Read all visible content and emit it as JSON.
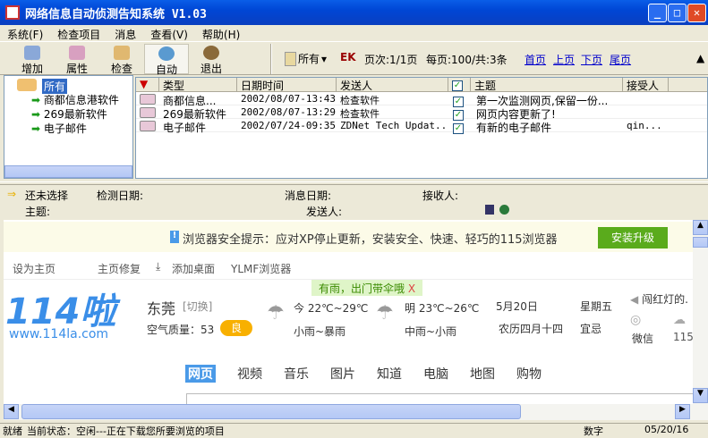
{
  "window": {
    "title": "网络信息自动侦测告知系统 V1.03"
  },
  "menu": [
    "系统(F)",
    "检查项目",
    "消息",
    "查看(V)",
    "帮助(H)"
  ],
  "toolbar": {
    "buttons": [
      "增加",
      "属性",
      "检查",
      "自动",
      "退出"
    ],
    "filter": "所有",
    "page_info": "页次:1/1页",
    "per_page": "每页:100/共:3条",
    "nav": [
      "首页",
      "上页",
      "下页",
      "尾页"
    ]
  },
  "tree": {
    "root": "所有",
    "items": [
      "商都信息港软件",
      "269最新软件",
      "电子邮件"
    ]
  },
  "list": {
    "columns": [
      "类型",
      "日期时间",
      "发送人",
      "主题",
      "接受人"
    ],
    "rows": [
      {
        "type": "商都信息...",
        "date": "2002/08/07-13:43",
        "sender": "检查软件",
        "subject": "第一次监测网页,保留一份...",
        "receiver": ""
      },
      {
        "type": "269最新软件",
        "date": "2002/08/07-13:29",
        "sender": "检查软件",
        "subject": "网页内容更新了!",
        "receiver": ""
      },
      {
        "type": "电子邮件",
        "date": "2002/07/24-09:35",
        "sender": "ZDNet Tech Updat...",
        "subject": "有新的电子邮件",
        "receiver": "qin..."
      }
    ]
  },
  "info": {
    "state": "还未选择",
    "check_date": "检测日期:",
    "msg_date": "消息日期:",
    "receiver": "接收人:",
    "subject": "主题:",
    "sender": "发送人:"
  },
  "browser": {
    "banner": "浏览器安全提示：应对XP停止更新，安装安全、快速、轻巧的115浏览器",
    "install": "安装升级",
    "links": [
      "设为主页",
      "主页修复",
      "添加桌面",
      "YLMF浏览器"
    ],
    "logo": "114啦",
    "logo_url": "www.114la.com",
    "tip": "有雨，出门带伞哦",
    "tip_close": "X",
    "city": "东莞",
    "switch": "[切换]",
    "air_label": "空气质量：53",
    "air_level": "良",
    "today": "今 22℃~29℃",
    "today_desc": "小雨~暴雨",
    "tomorrow": "明 23℃~26℃",
    "tomorrow_desc": "中雨~小雨",
    "date": "5月20日",
    "lunar": "农历四月十四",
    "weekday": "星期五",
    "yiji": "宜忌",
    "news": "闯红灯的.",
    "wechat": "微信",
    "s115": "115",
    "tabs": [
      "网页",
      "视频",
      "音乐",
      "图片",
      "知道",
      "电脑",
      "地图",
      "购物"
    ]
  },
  "status": {
    "ready": "就绪",
    "state": "当前状态：空闲---正在下载您所要浏览的项目",
    "num": "数字",
    "date": "05/20/16"
  },
  "colors": {
    "title": "#0a5ee8",
    "accent": "#4a9ae8",
    "install": "#5aab1c"
  }
}
